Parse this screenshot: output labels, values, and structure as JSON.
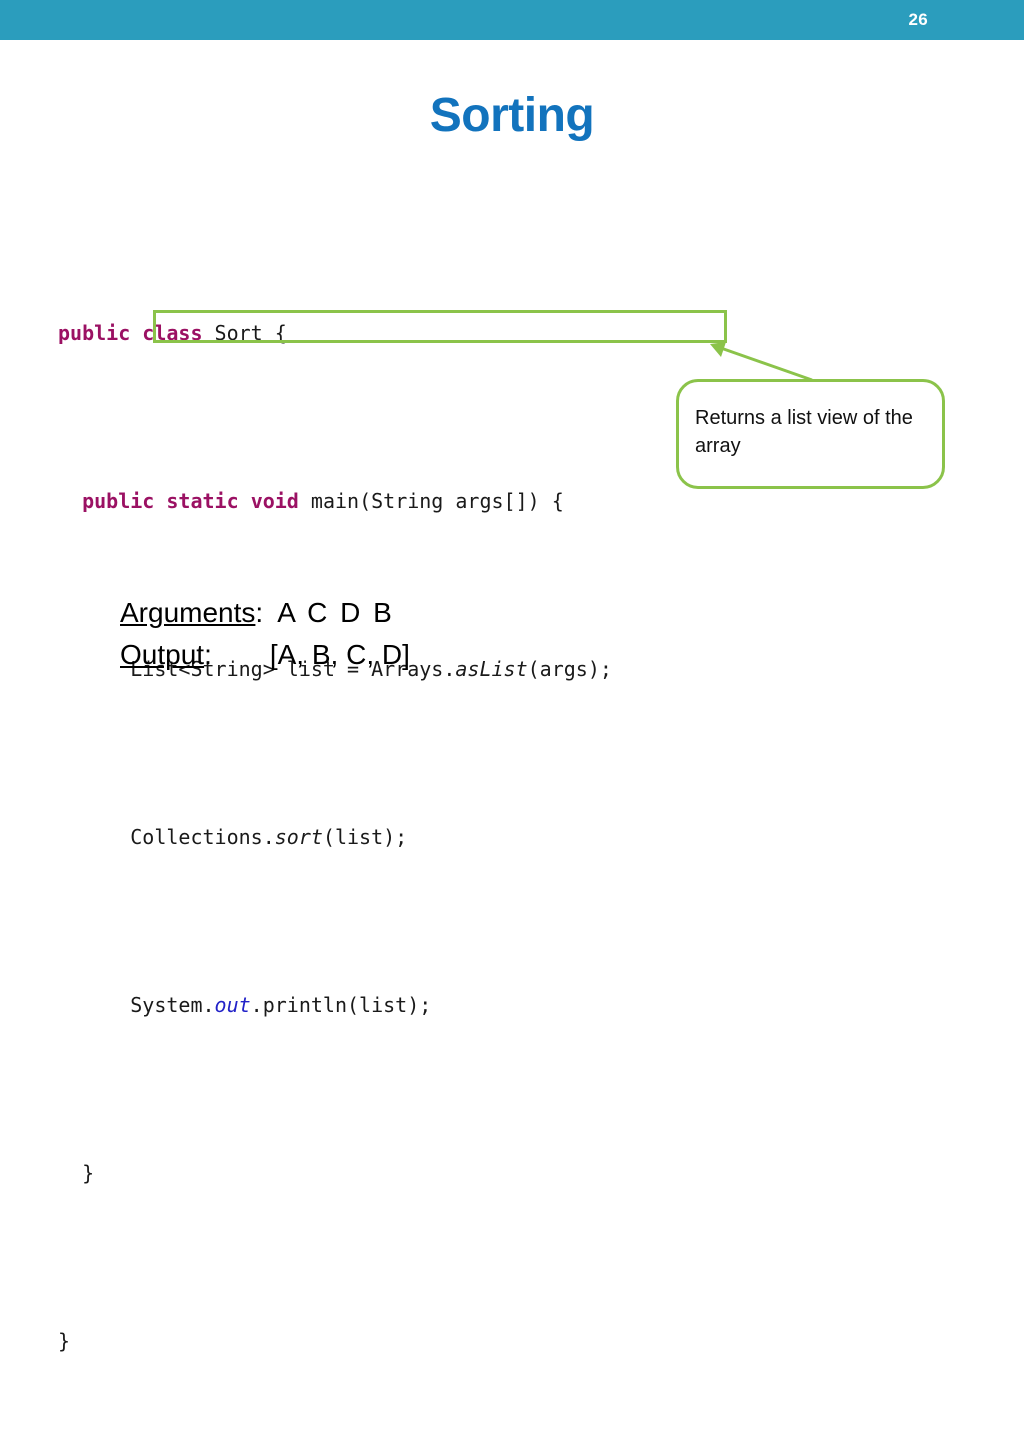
{
  "slide": {
    "page_number": "26",
    "title": "Sorting",
    "topbar_color": "#2b9dbd",
    "title_color": "#1273bd",
    "accent_green": "#8bc34a",
    "keyword_color": "#9b1163",
    "identifier_blue": "#2222c8"
  },
  "code": {
    "lines": [
      {
        "indent": "",
        "tokens": [
          {
            "text": "public",
            "style": "keyword"
          },
          {
            "text": " ",
            "style": "plain"
          },
          {
            "text": "class",
            "style": "keyword"
          },
          {
            "text": " Sort {",
            "style": "plain"
          }
        ],
        "plain": "public class Sort {"
      },
      {
        "indent": "  ",
        "tokens": [
          {
            "text": "public",
            "style": "keyword"
          },
          {
            "text": " ",
            "style": "plain"
          },
          {
            "text": "static",
            "style": "keyword"
          },
          {
            "text": " ",
            "style": "plain"
          },
          {
            "text": "void",
            "style": "keyword"
          },
          {
            "text": " main(String args[]) {",
            "style": "plain"
          }
        ],
        "plain": "  public static void main(String args[]) {"
      },
      {
        "indent": "      ",
        "tokens": [
          {
            "text": "List<String> list = Arrays.",
            "style": "plain"
          },
          {
            "text": "asList",
            "style": "italic"
          },
          {
            "text": "(args);",
            "style": "plain"
          }
        ],
        "plain": "      List<String> list = Arrays.asList(args);"
      },
      {
        "indent": "      ",
        "tokens": [
          {
            "text": "Collections.",
            "style": "plain"
          },
          {
            "text": "sort",
            "style": "italic"
          },
          {
            "text": "(list);",
            "style": "plain"
          }
        ],
        "plain": "      Collections.sort(list);"
      },
      {
        "indent": "      ",
        "tokens": [
          {
            "text": "System.",
            "style": "plain"
          },
          {
            "text": "out",
            "style": "blue-italic"
          },
          {
            "text": ".println(list);",
            "style": "plain"
          }
        ],
        "plain": "      System.out.println(list);"
      },
      {
        "indent": "  ",
        "tokens": [
          {
            "text": "}",
            "style": "plain"
          }
        ],
        "plain": "  }"
      },
      {
        "indent": "",
        "tokens": [
          {
            "text": "}",
            "style": "plain"
          }
        ],
        "plain": "}"
      }
    ],
    "line_1": "public class Sort {",
    "line_2_kw1": "public",
    "line_2_kw2": "static",
    "line_2_kw3": "void",
    "line_2_rest": " main(String args[]) {",
    "line_1_kw1": "public",
    "line_1_kw2": "class",
    "line_1_rest": " Sort {",
    "line_3_a": "List<String> list = Arrays.",
    "line_3_b": "asList",
    "line_3_c": "(args);",
    "line_4_a": "Collections.",
    "line_4_b": "sort",
    "line_4_c": "(list);",
    "line_5_a": "System.",
    "line_5_b": "out",
    "line_5_c": ".println(list);",
    "line_6": "}",
    "line_7": "}"
  },
  "callout": {
    "text": "Returns a list view of the array",
    "target_line": "List<String> list = Arrays.asList(args);"
  },
  "io": {
    "arguments_label": "Arguments",
    "arguments_colon": ":",
    "arguments_value": "A C D B",
    "output_label": "Output",
    "output_colon": ":",
    "output_value": "[A, B, C, D]"
  }
}
